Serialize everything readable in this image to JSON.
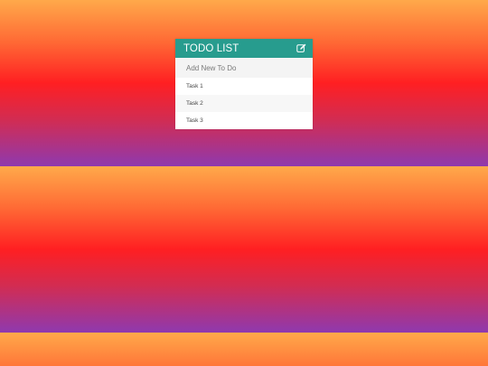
{
  "todo": {
    "title": "TODO LIST",
    "header_icon": "edit-icon",
    "input_placeholder": "Add New To Do",
    "tasks": [
      {
        "label": "Task 1"
      },
      {
        "label": "Task 2"
      },
      {
        "label": "Task 3"
      }
    ]
  },
  "colors": {
    "header": "#279c8e",
    "gradient_top": "#ffa94a",
    "gradient_middle": "#ff1f22",
    "gradient_bottom": "#8f39af"
  }
}
